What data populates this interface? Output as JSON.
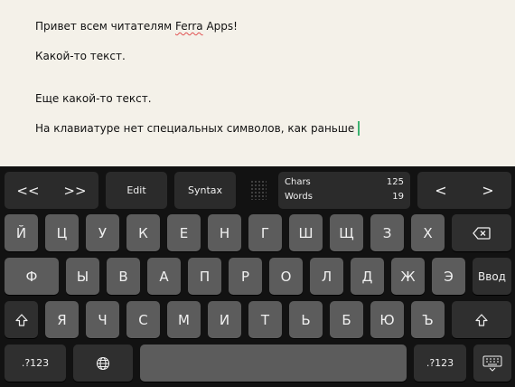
{
  "editor": {
    "lines": [
      "Привет всем читателям ",
      "Какой-то текст.",
      "Еще какой-то текст.",
      "На клавиатуре нет специальных символов, как раньше"
    ],
    "brand_word": "Ferra",
    "line1_suffix": " Apps!"
  },
  "toolbar": {
    "back_label": "<<",
    "forward_label": ">>",
    "edit_label": "Edit",
    "syntax_label": "Syntax",
    "chars_label": "Chars",
    "chars_value": "125",
    "words_label": "Words",
    "words_value": "19",
    "left_label": "<",
    "right_label": ">"
  },
  "keys": {
    "row1": [
      "Й",
      "Ц",
      "У",
      "К",
      "Е",
      "Н",
      "Г",
      "Ш",
      "Щ",
      "З",
      "Х"
    ],
    "row2": [
      "Ф",
      "Ы",
      "В",
      "А",
      "П",
      "Р",
      "О",
      "Л",
      "Д",
      "Ж",
      "Э"
    ],
    "row3": [
      "Я",
      "Ч",
      "С",
      "М",
      "И",
      "Т",
      "Ь",
      "Б",
      "Ю",
      "Ъ"
    ],
    "enter_label": "Ввод",
    "numbers_label": ".?123",
    "numbers_label_right": ".?123"
  },
  "icons": {
    "backspace": "backspace-icon",
    "shift": "shift-icon",
    "globe": "globe-icon",
    "hide_keyboard": "keyboard-hide-icon"
  },
  "colors": {
    "editor_bg": "#f4f1e9",
    "keyboard_bg": "#121212",
    "key_bg": "#5c5c5c",
    "key_dark_bg": "#2f2f2f",
    "cursor": "#3cb371"
  }
}
